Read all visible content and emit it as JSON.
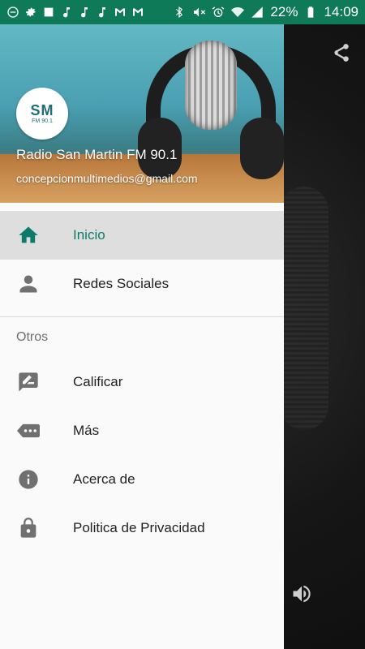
{
  "status_bar": {
    "battery": "22%",
    "time": "14:09",
    "icons": [
      "minus-circle-icon",
      "gear-icon",
      "image-icon",
      "music-note-icon",
      "music-note-icon",
      "music-note-icon",
      "gmail-icon",
      "gmail-icon",
      "bluetooth-icon",
      "mute-icon",
      "alarm-icon",
      "wifi-icon",
      "signal-icon"
    ]
  },
  "drawer": {
    "header": {
      "avatar_text": "SM",
      "avatar_subtext": "FM 90.1",
      "station_name": "Radio San Martin FM 90.1",
      "email": "concepcionmultimedios@gmail.com"
    },
    "items": [
      {
        "label": "Inicio",
        "icon": "home-icon",
        "active": true
      },
      {
        "label": "Redes Sociales",
        "icon": "person-icon",
        "active": false
      }
    ],
    "section_title": "Otros",
    "other_items": [
      {
        "label": "Calificar",
        "icon": "rate-review-icon"
      },
      {
        "label": "Más",
        "icon": "more-tag-icon"
      },
      {
        "label": "Acerca de",
        "icon": "info-icon"
      },
      {
        "label": "Politica de Privacidad",
        "icon": "lock-icon"
      }
    ]
  },
  "background_app": {
    "share_icon": "share-icon",
    "volume_icon": "volume-icon"
  },
  "colors": {
    "status_bar": "#0f7a57",
    "accent": "#0e7b6a",
    "active_bg": "#dedede"
  }
}
